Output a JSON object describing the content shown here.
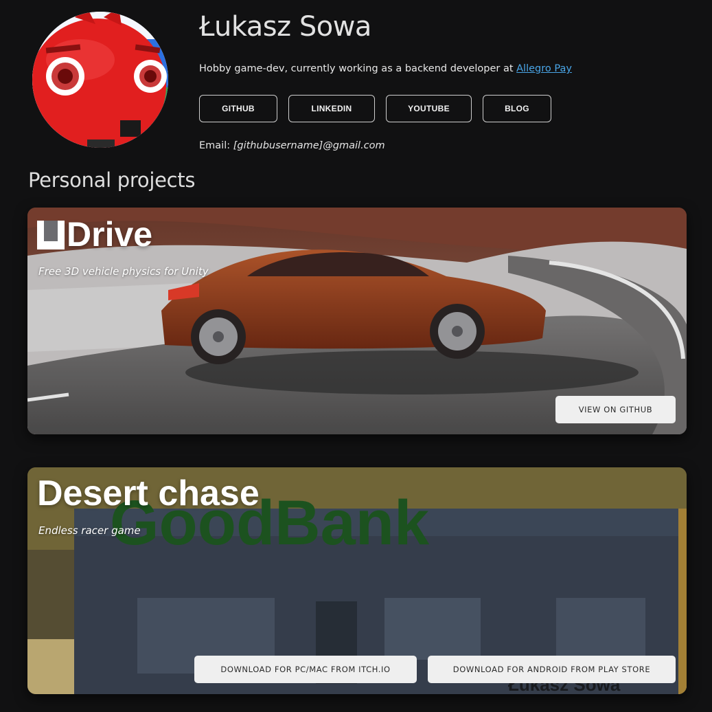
{
  "profile": {
    "name": "Łukasz Sowa",
    "bio_text": "Hobby game-dev, currently working as a backend developer at ",
    "bio_link": "Allegro Pay",
    "email_label": "Email: ",
    "email_value": "[githubusername]@gmail.com"
  },
  "social_links": [
    {
      "label": "GITHUB"
    },
    {
      "label": "LINKEDIN"
    },
    {
      "label": "YOUTUBE"
    },
    {
      "label": "BLOG"
    }
  ],
  "section": {
    "title": "Personal projects"
  },
  "projects": [
    {
      "title_logo": "U",
      "title": "Drive",
      "subtitle": "Free 3D vehicle physics for Unity",
      "buttons": [
        {
          "label": "VIEW ON GITHUB"
        }
      ]
    },
    {
      "title": "Desert chase",
      "subtitle": "Endless racer game",
      "background_sign": "GoodBank",
      "watermark": "Łukasz Sowa",
      "buttons": [
        {
          "label": "DOWNLOAD FOR PC/MAC FROM ITCH.IO"
        },
        {
          "label": "DOWNLOAD FOR ANDROID FROM PLAY STORE"
        }
      ]
    }
  ],
  "colors": {
    "background": "#111112",
    "link": "#4aa6e8",
    "button_bg": "#efefef"
  }
}
